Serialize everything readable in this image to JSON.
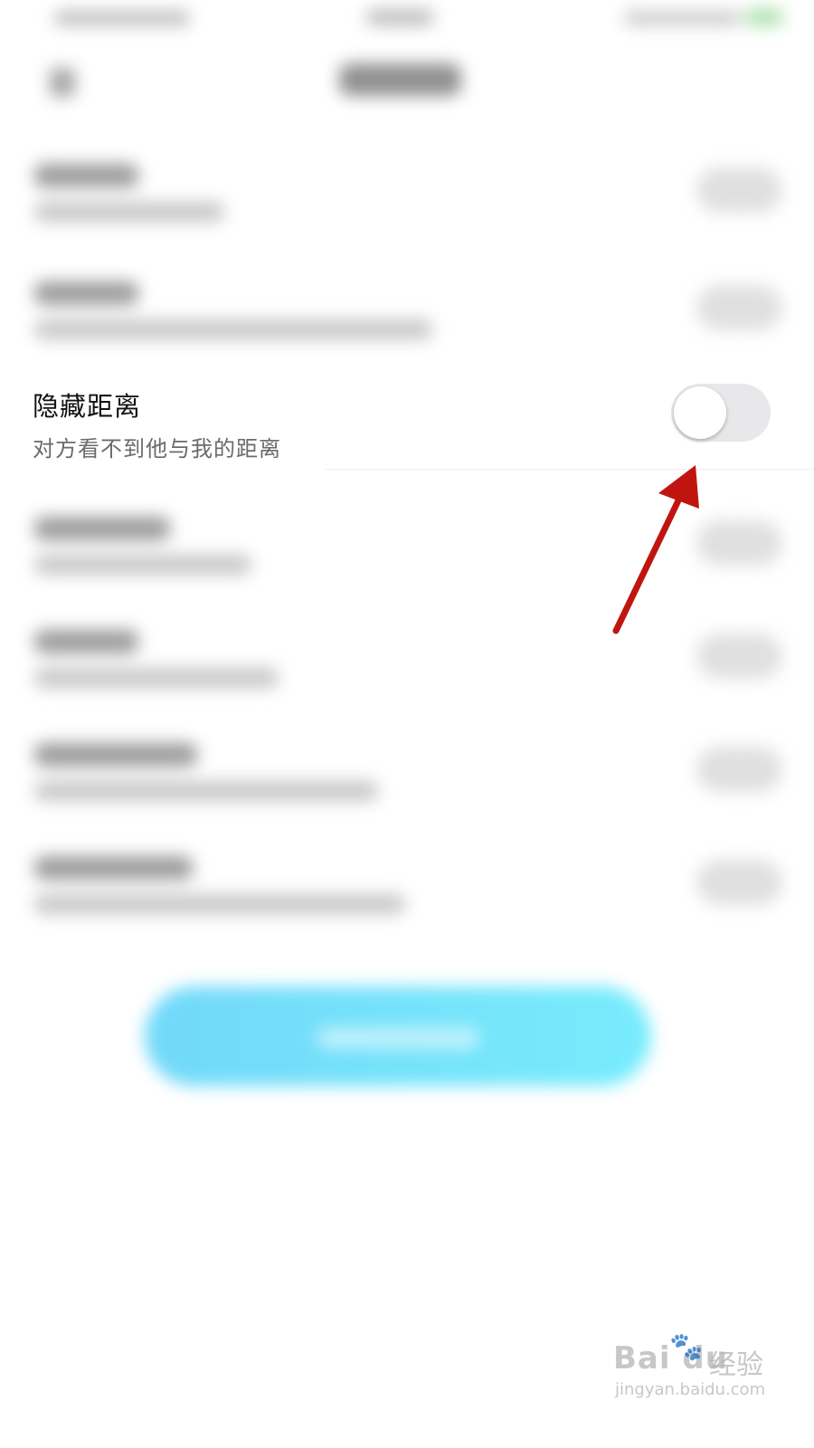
{
  "setting": {
    "title": "隐藏距离",
    "description": "对方看不到他与我的距离",
    "toggle_on": false
  },
  "watermark": {
    "brand": "Bai du",
    "label": "经验",
    "url": "jingyan.baidu.com"
  },
  "colors": {
    "arrow": "#c0150f",
    "toggle_off_track": "#e8e8ea",
    "button_gradient_start": "#27c4f6",
    "button_gradient_end": "#2fe2fb"
  },
  "icons": {
    "back": "chevron-left-icon",
    "watermark_paw": "paw-icon"
  }
}
